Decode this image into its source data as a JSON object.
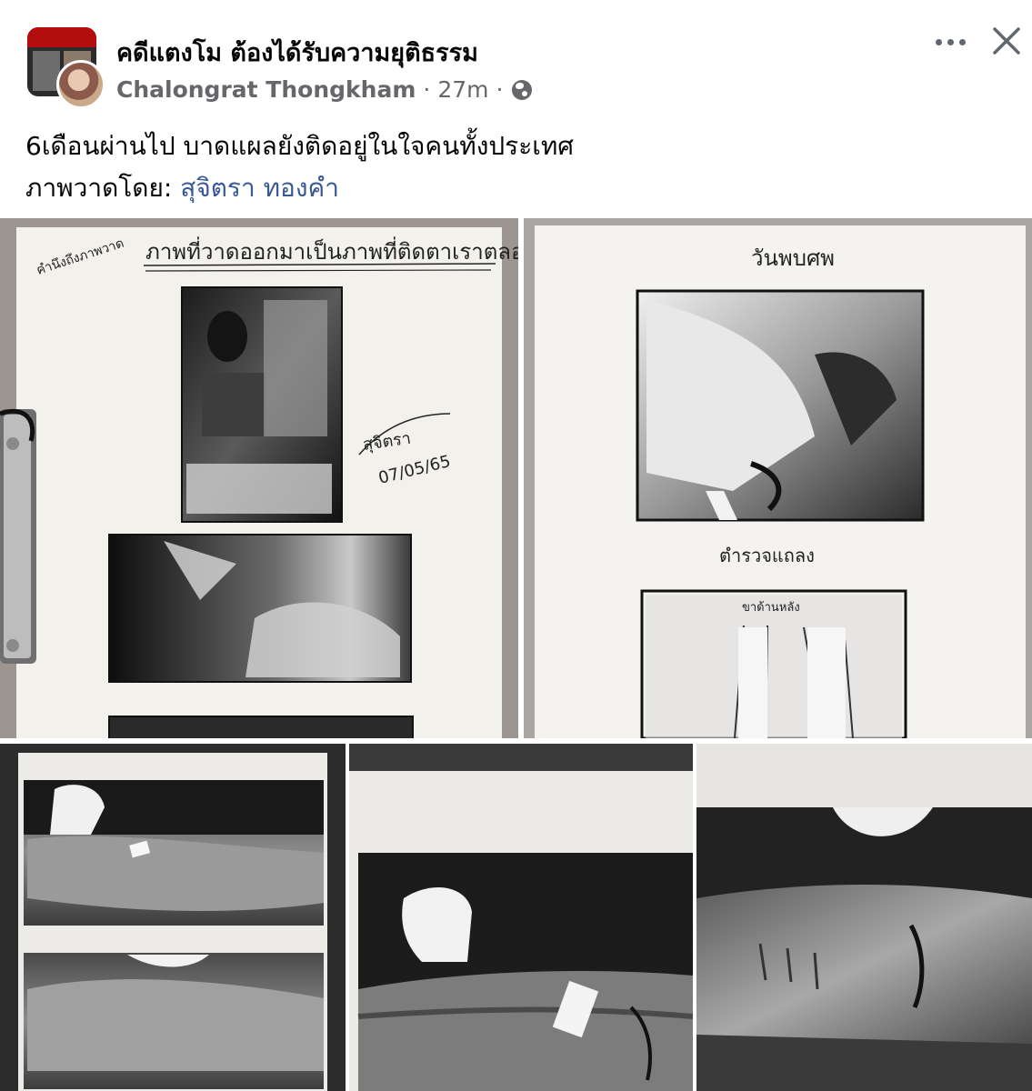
{
  "post": {
    "group_name": "คดีแตงโม ต้องได้รับความยุติธรรม",
    "author": "Chalongrat Thongkham",
    "separator": "·",
    "time": "27m",
    "text_line1": "6เดือนผ่านไป บาดแผลยังติดอยู่ในใจคนทั้งประเทศ",
    "credit_label": "ภาพวาดโดย: ",
    "credit_name": "สุจิตรา ทองคำ",
    "privacy_icon": "globe-icon",
    "more_icon": "more-options-icon",
    "close_icon": "close-icon"
  },
  "photos": {
    "photo1": {
      "heading": "ภาพที่วาดออกมาเป็นภาพที่ติดตาเราตลอด",
      "corner_note": "คำนึงถึงภาพวาด",
      "signature": "สุจิตรา",
      "date": "07/05/65"
    },
    "photo2": {
      "heading": "วันพบศพ",
      "subheading": "ตำรวจแถลง",
      "panel_label": "ขาด้านหลัง"
    }
  },
  "colors": {
    "link": "#385898",
    "secondary_text": "#65676b",
    "paper": "#f3f1ec",
    "backdrop": "#9c9590"
  }
}
